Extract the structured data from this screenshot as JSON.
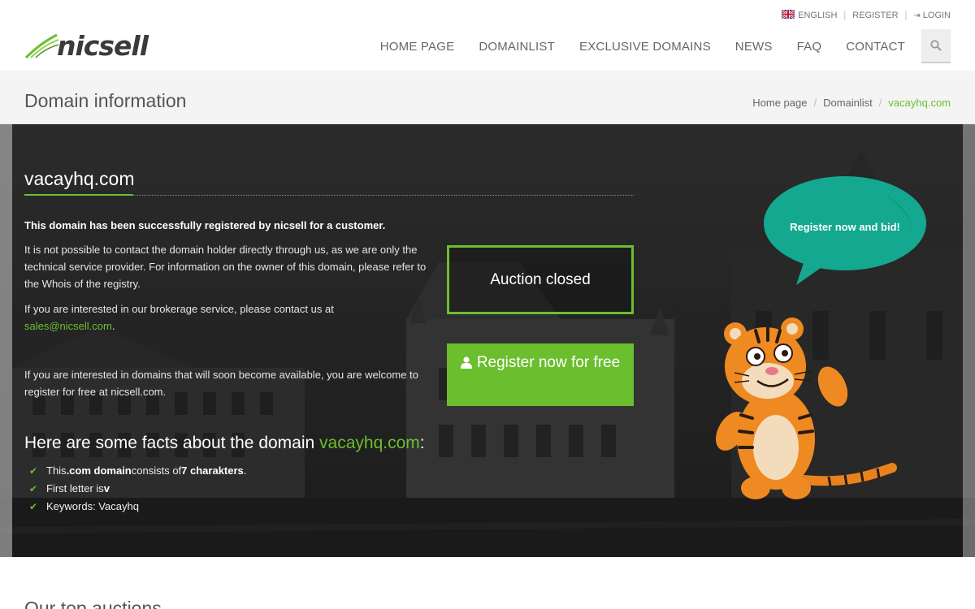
{
  "topbar": {
    "language": "ENGLISH",
    "register": "REGISTER",
    "login": "LOGIN"
  },
  "header": {
    "logo_text": "nicsell",
    "nav": [
      "HOME PAGE",
      "DOMAINLIST",
      "EXCLUSIVE DOMAINS",
      "NEWS",
      "FAQ",
      "CONTACT"
    ]
  },
  "page": {
    "title": "Domain information",
    "breadcrumb": [
      "Home page",
      "Domainlist",
      "vacayhq.com"
    ]
  },
  "hero": {
    "domain": "vacayhq.com",
    "registered_notice": "This domain has been successfully registered by nicsell for a customer.",
    "contact_notice": "It is not possible to contact the domain holder directly through us, as we are only the technical service provider. For information on the owner of this domain, please refer to the Whois of the registry.",
    "brokerage_text": "If you are interested in our brokerage service, please contact us at",
    "brokerage_email": "sales@nicsell.com",
    "brokerage_end": ".",
    "upcoming_text": "If you are interested in domains that will soon become available, you are welcome to register for free at nicsell.com.",
    "auction_status": "Auction closed",
    "register_button": "Register now for free",
    "bubble_text": "Register now and bid!",
    "facts_title_prefix": "Here are some facts about the domain ",
    "facts_title_domain": "vacayhq.com",
    "facts_title_suffix": ":",
    "facts": {
      "f1_a": "This ",
      "f1_b": ".com domain",
      "f1_c": " consists of ",
      "f1_d": "7 charakters",
      "f1_e": ".",
      "f2_a": "First letter is ",
      "f2_b": "v",
      "f3": "Keywords: Vacayhq"
    }
  },
  "below": {
    "section_title": "Our top auctions"
  },
  "colors": {
    "accent": "#6bbf2e",
    "bubble": "#13a88f"
  }
}
